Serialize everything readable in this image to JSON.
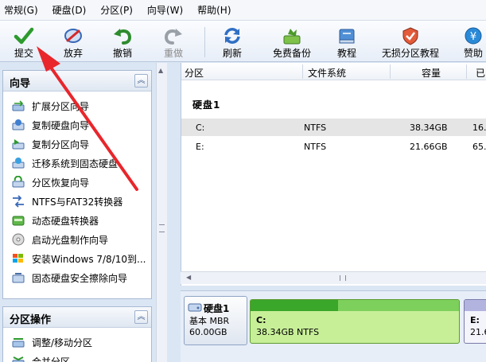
{
  "menu": [
    "常规(G)",
    "硬盘(D)",
    "分区(P)",
    "向导(W)",
    "帮助(H)"
  ],
  "toolbar": {
    "submit": "提交",
    "discard": "放弃",
    "undo": "撤销",
    "redo": "重做",
    "refresh": "刷新",
    "backup": "免费备份",
    "tutorial": "教程",
    "lossless": "无损分区教程",
    "sponsor": "赞助"
  },
  "wizard_panel": {
    "title": "向导",
    "items": [
      "扩展分区向导",
      "复制硬盘向导",
      "复制分区向导",
      "迁移系统到固态硬盘",
      "分区恢复向导",
      "NTFS与FAT32转换器",
      "动态硬盘转换器",
      "启动光盘制作向导",
      "安装Windows 7/8/10到...",
      "固态硬盘安全擦除向导"
    ]
  },
  "ops_panel": {
    "title": "分区操作",
    "items": [
      "调整/移动分区",
      "合并分区"
    ]
  },
  "table": {
    "headers": [
      "分区",
      "文件系统",
      "容量",
      "已"
    ],
    "disk_label": "硬盘1",
    "rows": [
      {
        "name": "C:",
        "fs": "NTFS",
        "capacity": "38.34GB",
        "used": "16.0"
      },
      {
        "name": "E:",
        "fs": "NTFS",
        "capacity": "21.66GB",
        "used": "65.1"
      }
    ]
  },
  "diskmap": {
    "disk_name": "硬盘1",
    "disk_type": "基本 MBR",
    "disk_size": "60.00GB",
    "partitions": [
      {
        "name": "C:",
        "desc": "38.34GB NTFS",
        "used_fraction": 0.42
      },
      {
        "name": "E:",
        "desc": "21.6"
      }
    ]
  },
  "colors": {
    "accent_green": "#3aa62a",
    "partition_fill": "#c7ef98",
    "arrow_red": "#e8262c"
  }
}
